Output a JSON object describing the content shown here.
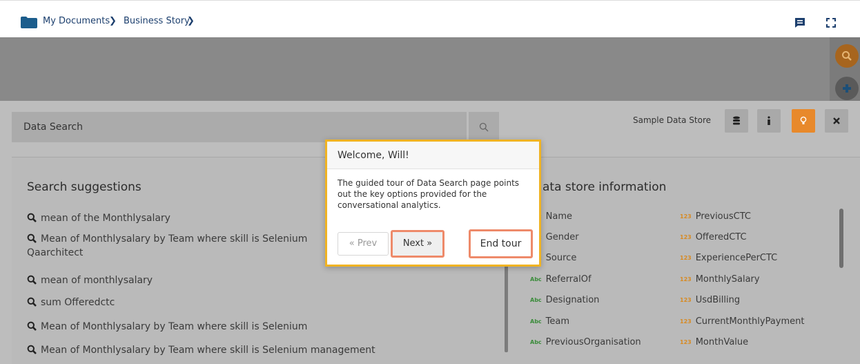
{
  "breadcrumb": {
    "items": [
      "My Documents",
      "Business Story"
    ],
    "separator": "❯"
  },
  "search": {
    "placeholder": "Data Search"
  },
  "store": {
    "label": "Sample Data Store"
  },
  "suggestions": {
    "title": "Search suggestions",
    "items": [
      "mean of the Monthlysalary",
      "Mean of Monthlysalary by Team where skill is Selenium",
      "Qaarchitect",
      "mean of monthlysalary",
      "sum Offeredctc",
      "Mean of Monthlysalary by Team where skill is Selenium",
      "Mean of Monthlysalary by Team where skill is Selenium management"
    ]
  },
  "store_info": {
    "title": "ata store information",
    "abc_badge": "Abc",
    "num_badge": "123",
    "left_fields": [
      "Name",
      "Gender",
      "Source",
      "ReferralOf",
      "Designation",
      "Team",
      "PreviousOrganisation"
    ],
    "right_fields": [
      "PreviousCTC",
      "OfferedCTC",
      "ExperiencePerCTC",
      "MonthlySalary",
      "UsdBilling",
      "CurrentMonthlyPayment",
      "MonthValue"
    ]
  },
  "tour": {
    "title": "Welcome, Will!",
    "body": "The guided tour of Data Search page points out the key options provided for the conversational analytics.",
    "prev_label": "« Prev",
    "next_label": "Next »",
    "end_label": "End tour"
  },
  "icons": {
    "folder": "folder-icon",
    "comment": "comment-icon",
    "fullscreen": "fullscreen-icon",
    "search": "search-icon",
    "add": "plus-icon",
    "database": "database-icon",
    "info": "info-icon",
    "bulb": "lightbulb-icon",
    "close": "close-icon"
  },
  "colors": {
    "brand": "#1c5d8c",
    "accent": "#e8892b",
    "tour_border": "#f0b323",
    "highlight": "#ee8a6a"
  }
}
